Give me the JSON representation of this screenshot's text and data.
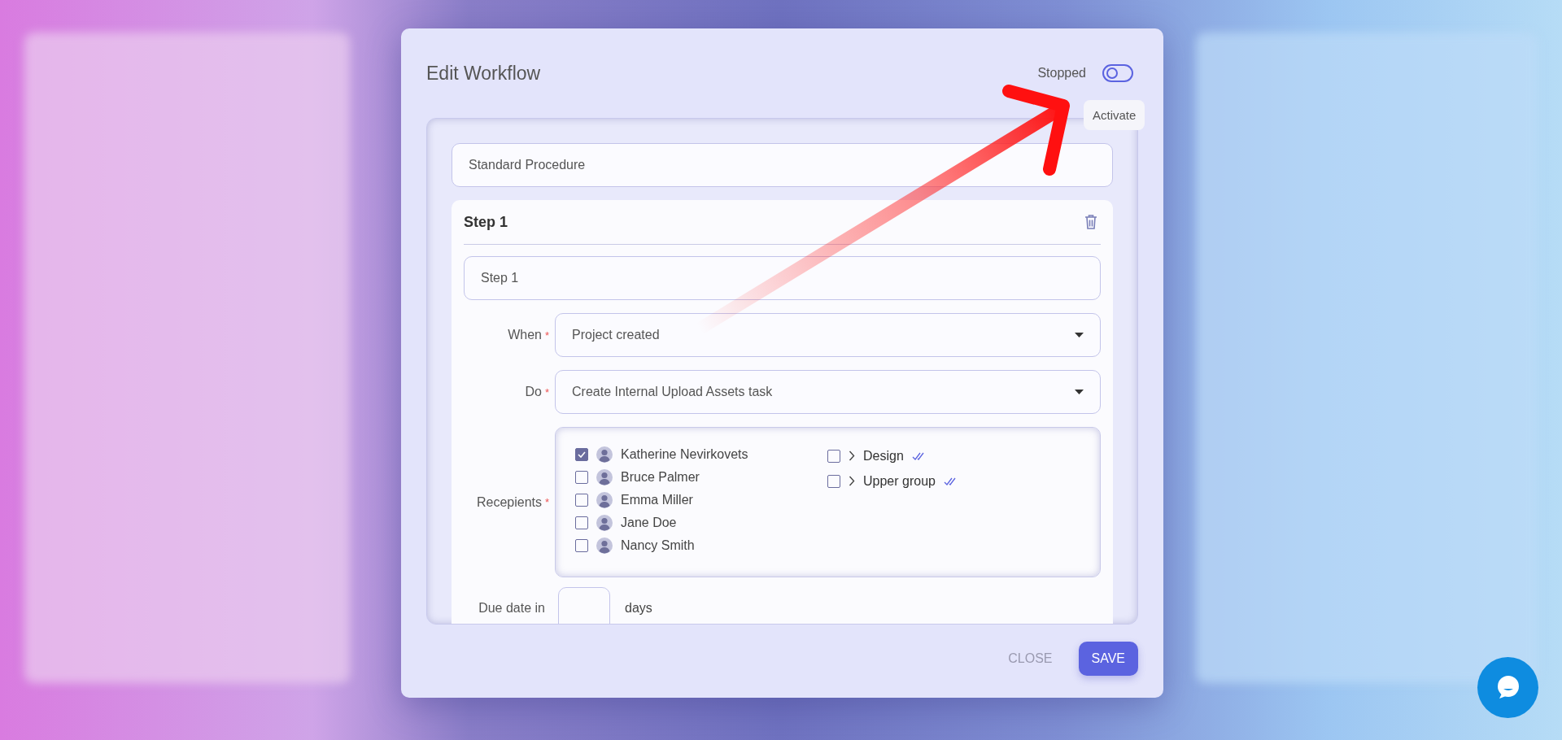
{
  "dialog": {
    "title": "Edit Workflow",
    "status_toggle": {
      "label": "Stopped",
      "on": false
    },
    "tooltip": "Activate",
    "workflow_name": {
      "value": "Standard Procedure"
    },
    "step": {
      "title": "Step 1",
      "name": {
        "value": "Step 1"
      },
      "when": {
        "label": "When",
        "required_mark": "*",
        "value": "Project created"
      },
      "do": {
        "label": "Do",
        "required_mark": "*",
        "value": "Create Internal Upload Assets task"
      },
      "recipients": {
        "label": "Recepients",
        "required_mark": "*",
        "people": [
          {
            "name": "Katherine Nevirkovets",
            "checked": true
          },
          {
            "name": "Bruce Palmer",
            "checked": false
          },
          {
            "name": "Emma Miller",
            "checked": false
          },
          {
            "name": "Jane Doe",
            "checked": false
          },
          {
            "name": "Nancy Smith",
            "checked": false
          }
        ],
        "groups": [
          {
            "name": "Design",
            "checked": false
          },
          {
            "name": "Upper group",
            "checked": false
          }
        ]
      },
      "due_date": {
        "label": "Due date in",
        "unit": "days"
      }
    },
    "buttons": [
      {
        "label": "CLOSE",
        "kind": "text"
      },
      {
        "label": "SAVE",
        "kind": "primary"
      }
    ]
  }
}
